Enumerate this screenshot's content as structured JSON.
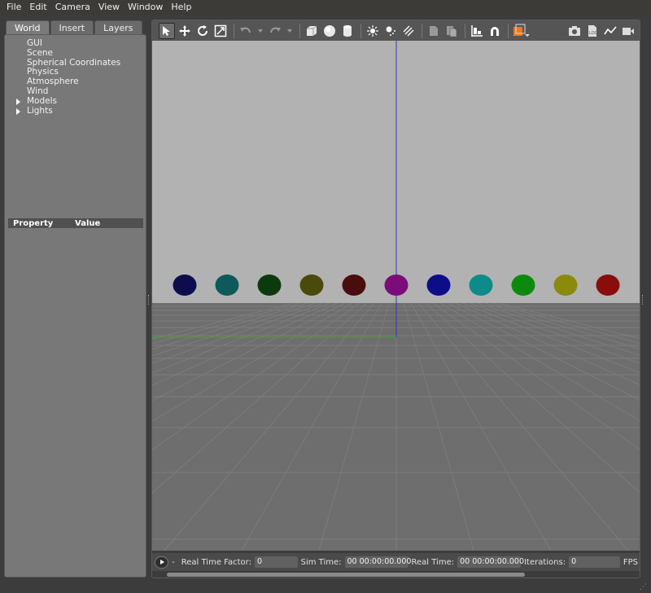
{
  "menu": [
    "File",
    "Edit",
    "Camera",
    "View",
    "Window",
    "Help"
  ],
  "left_panel": {
    "tabs": [
      "World",
      "Insert",
      "Layers"
    ],
    "active_tab": "World",
    "tree": [
      {
        "label": "GUI",
        "expandable": false
      },
      {
        "label": "Scene",
        "expandable": false
      },
      {
        "label": "Spherical Coordinates",
        "expandable": false
      },
      {
        "label": "Physics",
        "expandable": false
      },
      {
        "label": "Atmosphere",
        "expandable": false
      },
      {
        "label": "Wind",
        "expandable": false
      },
      {
        "label": "Models",
        "expandable": true
      },
      {
        "label": "Lights",
        "expandable": true
      }
    ],
    "property_header": {
      "property": "Property",
      "value": "Value"
    }
  },
  "toolbar": {
    "left_icons": [
      "select-arrow-icon",
      "translate-icon",
      "rotate-icon",
      "scale-icon",
      "undo-icon",
      "undo-dropdown-icon",
      "redo-icon",
      "redo-dropdown-icon",
      "box-shape-icon",
      "sphere-shape-icon",
      "cylinder-shape-icon",
      "point-light-icon",
      "spot-light-icon",
      "directional-light-icon",
      "copy-icon",
      "paste-icon",
      "align-icon",
      "snap-icon",
      "view-angle-icon"
    ],
    "right_icons": [
      "screenshot-icon",
      "log-icon",
      "plot-icon",
      "record-video-icon"
    ]
  },
  "scene": {
    "sky_color": "#b2b2b2",
    "ground_color": "#6e6e6e",
    "spheres": [
      "#0d0d4d",
      "#0d5a5a",
      "#0d3a0d",
      "#4a4a0d",
      "#4a0d0d",
      "#7a0d7a",
      "#0d0d8a",
      "#0d8a8a",
      "#0d8a0d",
      "#8a8a0d",
      "#8a0d0d"
    ],
    "z_axis_color": "#3333cc",
    "x_axis_color": "#33aa33"
  },
  "bottom_bar": {
    "separator": "-",
    "real_time_factor_label": "Real Time Factor:",
    "real_time_factor_value": "0",
    "sim_time_label": "Sim Time:",
    "sim_time_value": "00 00:00:00.000",
    "real_time_label": "Real Time:",
    "real_time_value": "00 00:00:00.000",
    "iterations_label": "Iterations:",
    "iterations_value": "0",
    "fps_label": "FPS"
  }
}
